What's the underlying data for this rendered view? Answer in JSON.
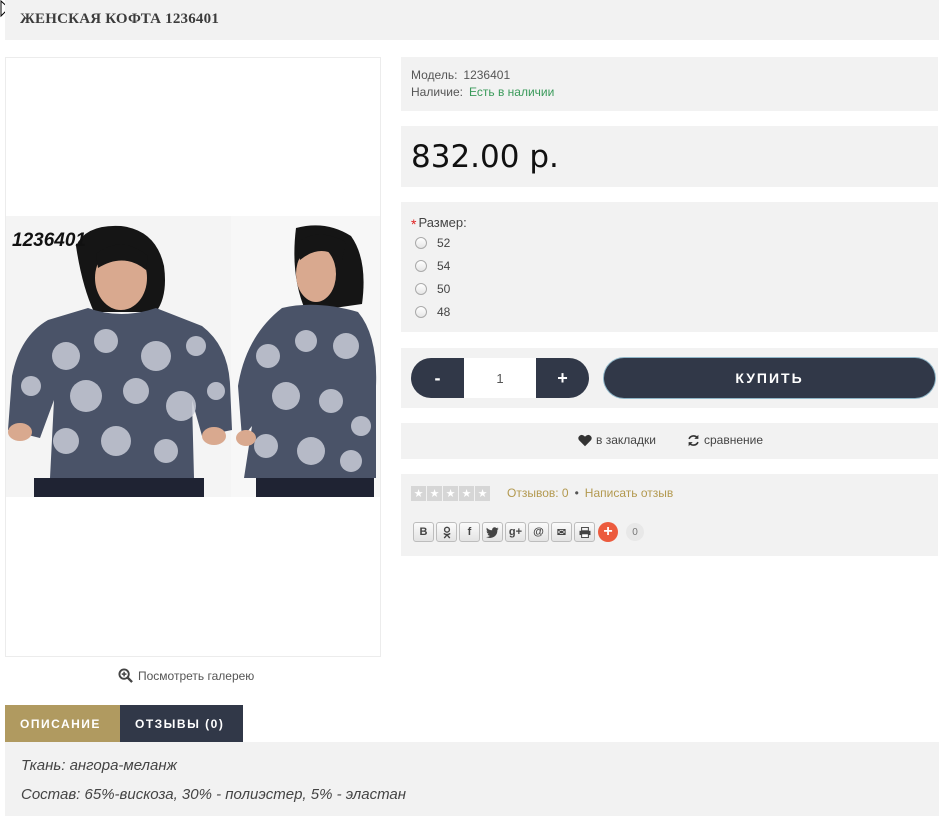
{
  "product": {
    "title": "ЖЕНСКАЯ КОФТА 1236401",
    "photo_code": "1236401"
  },
  "gallery": {
    "label": "Посмотреть галерею"
  },
  "info": {
    "model_label": "Модель:",
    "model_value": "1236401",
    "stock_label": "Наличие:",
    "stock_value": "Есть в наличии"
  },
  "price": "832.00 р.",
  "sizes": {
    "label": "Размер:",
    "options": [
      "52",
      "54",
      "50",
      "48"
    ]
  },
  "cart": {
    "minus": "-",
    "plus": "+",
    "quantity": "1",
    "buy_label": "КУПИТЬ"
  },
  "actions": {
    "wishlist": "в закладки",
    "compare": "сравнение"
  },
  "reviews": {
    "rating": 0,
    "count_label": "Отзывов: 0",
    "separator": "•",
    "write_label": "Написать отзыв"
  },
  "share": {
    "buttons": [
      "В",
      "ok",
      "f",
      "t",
      "g+",
      "@",
      "✉",
      "print"
    ],
    "count": "0"
  },
  "tabs": [
    {
      "label": "ОПИСАНИЕ",
      "active": true
    },
    {
      "label": "ОТЗЫВЫ (0)",
      "active": false
    }
  ],
  "description": {
    "line1": "Ткань: ангора-меланж",
    "line2": "Состав: 65%-вискоза, 30% - полиэстер, 5% - эластан"
  },
  "colors": {
    "dark": "#313848",
    "gold": "#b09a60",
    "panel": "#f2f2f2",
    "stock_green": "#3a9a5a",
    "share_orange": "#ec5b3e"
  }
}
